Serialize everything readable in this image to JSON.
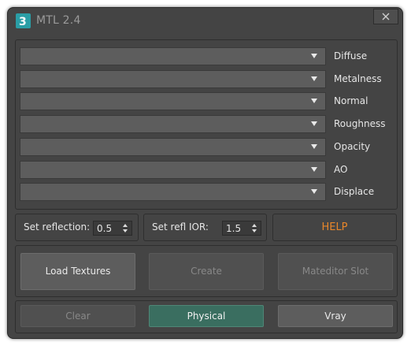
{
  "window": {
    "title": "MTL 2.4",
    "app_icon": "3ds-max-icon",
    "close_icon": "close-icon"
  },
  "maps": [
    {
      "label": "Diffuse"
    },
    {
      "label": "Metalness"
    },
    {
      "label": "Normal"
    },
    {
      "label": "Roughness"
    },
    {
      "label": "Opacity"
    },
    {
      "label": "AO"
    },
    {
      "label": "Displace"
    }
  ],
  "settings": {
    "reflection_label": "Set reflection:",
    "reflection_value": "0.5",
    "ior_label": "Set refl IOR:",
    "ior_value": "1.5",
    "help_label": "HELP"
  },
  "actions": {
    "load_textures": "Load Textures",
    "create": "Create",
    "mateditor_slot": "Mateditor Slot"
  },
  "bottom": {
    "clear": "Clear",
    "physical": "Physical",
    "vray": "Vray"
  },
  "colors": {
    "accent_help": "#e8862a",
    "active_button": "#3a6e60",
    "app_icon": "#2a9ea6"
  }
}
